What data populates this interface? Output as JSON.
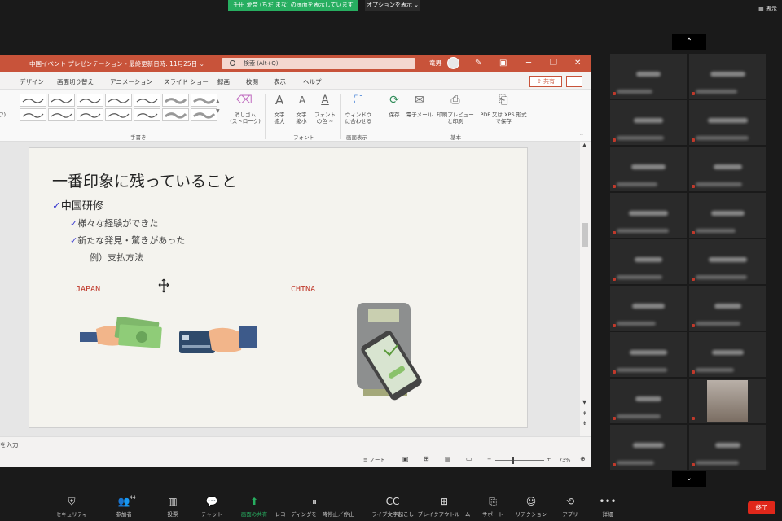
{
  "zoom_banner": {
    "text": "千田 愛奈 (ちだ まな) の画面を表示しています",
    "options": "オプションを表示 ⌄",
    "view": "表示"
  },
  "ppt": {
    "doc_title": "中国イベント プレゼンテーション - 最終更新日時: 11月25日 ⌄",
    "search_placeholder": "検索 (Alt+Q)",
    "user": "竜男",
    "tabs": [
      "デザイン",
      "画面切り替え",
      "アニメーション",
      "スライド ショー",
      "録画",
      "校閲",
      "表示",
      "ヘルプ"
    ],
    "share": "共有",
    "ribbon": {
      "pen_group": "手書き",
      "eraser": [
        "消しゴム",
        "(ストローク)"
      ],
      "font_btns": [
        [
          "文字",
          "拡大"
        ],
        [
          "文字",
          "縮小"
        ],
        [
          "フォント",
          "の色 ~"
        ]
      ],
      "font_group": "フォント",
      "window_btn": [
        "ウィンドウ",
        "に合わせる"
      ],
      "window_group": "画面表示",
      "basic_btns": [
        [
          "保存",
          ""
        ],
        [
          "電子メール",
          ""
        ],
        [
          "印刷プレビュー",
          "と印刷"
        ],
        [
          "PDF 又は XPS 形式",
          "で保存"
        ]
      ],
      "basic_group": "基本",
      "left_stub": "ワ)"
    },
    "slide": {
      "title": "一番印象に残っていること",
      "bullet": "中国研修",
      "sub1": "様々な経験ができた",
      "sub2": "新たな発見・驚きがあった",
      "sub3": "例）支払方法",
      "label_japan": "JAPAN",
      "label_china": "CHINA",
      "check": "✓"
    },
    "notes_placeholder": "を入力",
    "status": {
      "notes": "ノート",
      "zoom": "73%"
    }
  },
  "gallery_count": 18,
  "toolbar": {
    "items": [
      {
        "label": "セキュリティ",
        "icon": "shield-icon",
        "glyph": "⛨"
      },
      {
        "label": "参加者",
        "icon": "participants-icon",
        "glyph": "👥",
        "badge": "44"
      },
      {
        "label": "投票",
        "icon": "poll-icon",
        "glyph": "▥"
      },
      {
        "label": "チャット",
        "icon": "chat-icon",
        "glyph": "💬"
      },
      {
        "label": "画面の共有",
        "icon": "share-screen-icon",
        "glyph": "⬆"
      },
      {
        "label": "レコーディングを一時停止／停止",
        "icon": "record-icon",
        "glyph": "⏸"
      },
      {
        "label": "ライブ文字起こし",
        "icon": "cc-icon",
        "glyph": "CC"
      },
      {
        "label": "ブレイクアウトルーム",
        "icon": "breakout-icon",
        "glyph": "⊞"
      },
      {
        "label": "サポート",
        "icon": "support-icon",
        "glyph": "⎘"
      },
      {
        "label": "リアクション",
        "icon": "reaction-icon",
        "glyph": "☺"
      },
      {
        "label": "アプリ",
        "icon": "apps-icon",
        "glyph": "⟲"
      },
      {
        "label": "詳細",
        "icon": "more-icon",
        "glyph": "•••"
      }
    ],
    "end": "終了"
  }
}
